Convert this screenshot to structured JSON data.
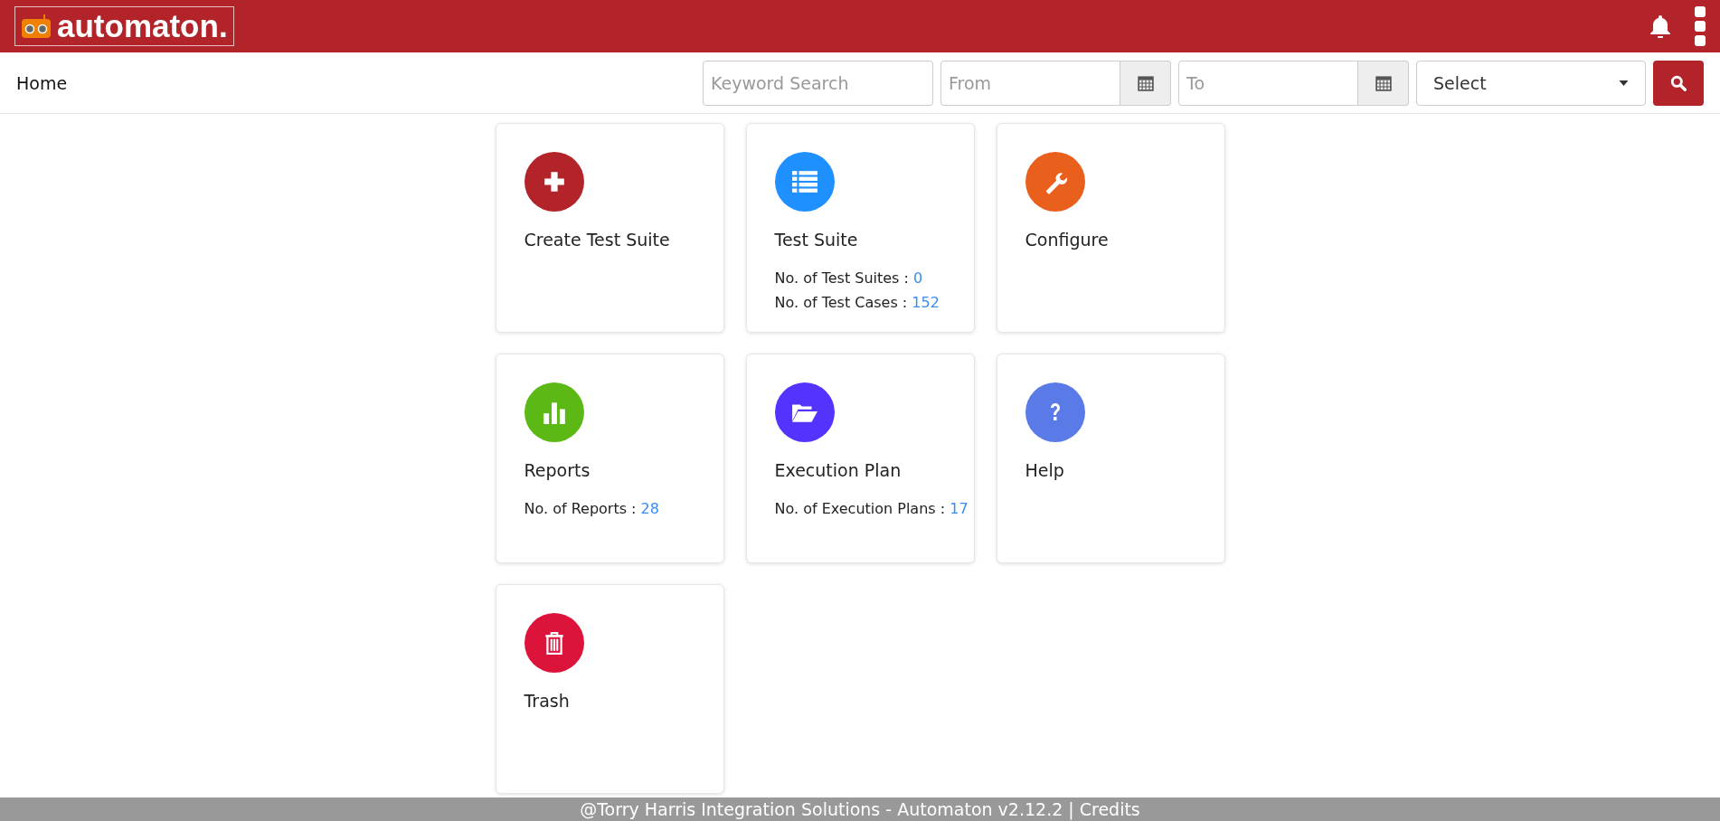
{
  "header": {
    "logo": "automaton."
  },
  "toolbar": {
    "breadcrumb": "Home",
    "keyword": {
      "placeholder": "Keyword Search"
    },
    "from": {
      "placeholder": "From"
    },
    "to": {
      "placeholder": "To"
    },
    "select": {
      "value": "Select"
    }
  },
  "cards": [
    {
      "kind": "plus",
      "color": "#b22429",
      "title": "Create Test Suite"
    },
    {
      "kind": "list",
      "color": "#1e90ff",
      "title": "Test Suite",
      "stats": [
        {
          "label": "No. of Test Suites : ",
          "value": "0"
        },
        {
          "label": "No. of Test Cases : ",
          "value": "152"
        }
      ]
    },
    {
      "kind": "wrench",
      "color": "#e8601c",
      "title": "Configure"
    },
    {
      "kind": "chart",
      "color": "#5cb815",
      "title": "Reports",
      "stats": [
        {
          "label": "No. of Reports : ",
          "value": "28"
        }
      ]
    },
    {
      "kind": "folder",
      "color": "#5533ff",
      "title": "Execution Plan",
      "stats": [
        {
          "label": "No. of Execution Plans : ",
          "value": "17"
        }
      ]
    },
    {
      "kind": "help",
      "color": "#5a7ae8",
      "title": "Help"
    },
    {
      "kind": "trash",
      "color": "#dc143c",
      "title": "Trash"
    }
  ],
  "footer": {
    "text": "@Torry Harris Integration Solutions - Automaton v2.12.2 |",
    "link": "Credits"
  }
}
